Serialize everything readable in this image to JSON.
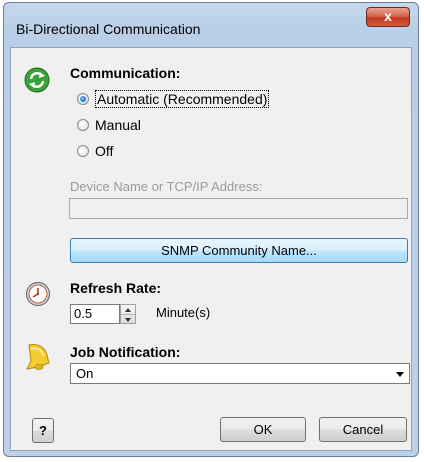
{
  "window": {
    "title": "Bi-Directional Communication",
    "close_glyph": "x"
  },
  "communication": {
    "label": "Communication:",
    "icon": "refresh-arrows-icon",
    "options": [
      {
        "label": "Automatic (Recommended)",
        "checked": true
      },
      {
        "label": "Manual",
        "checked": false
      },
      {
        "label": "Off",
        "checked": false
      }
    ],
    "device_field": {
      "label": "Device Name or TCP/IP Address:",
      "value": ""
    },
    "snmp_button": "SNMP Community Name..."
  },
  "refresh": {
    "label": "Refresh Rate:",
    "icon": "clock-icon",
    "value": "0.5",
    "unit": "Minute(s)"
  },
  "job_notification": {
    "label": "Job Notification:",
    "icon": "bell-icon",
    "selected": "On"
  },
  "buttons": {
    "help": "?",
    "ok": "OK",
    "cancel": "Cancel"
  },
  "colors": {
    "title_bar": "#bcd1e8",
    "close_button": "#c23b22",
    "accent_button": "#bee6fd"
  }
}
